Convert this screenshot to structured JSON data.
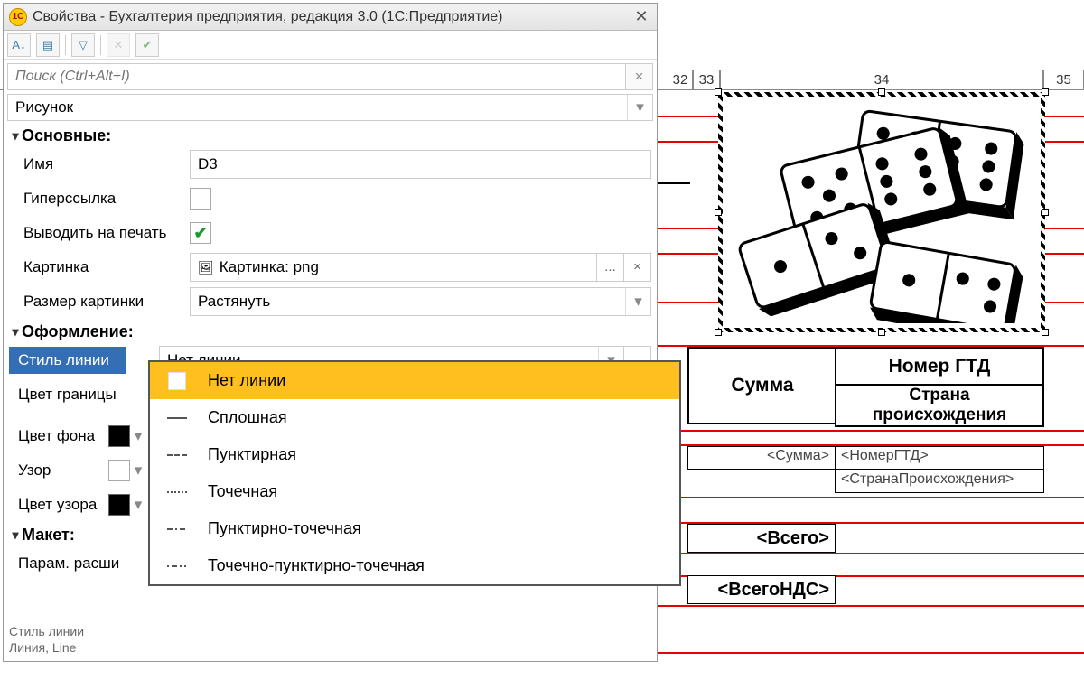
{
  "ruler": {
    "c32": "32",
    "c33": "33",
    "c34": "34",
    "c35": "35"
  },
  "grid": {
    "summ": "Сумма",
    "gtd": "Номер ГТД",
    "country": "Страна\nпроисхождения",
    "ph_summ": "<Сумма>",
    "ph_gtd": "<НомерГТД>",
    "ph_country": "<СтранаПроисхождения>",
    "total1": "<Всего>",
    "total2": "<ВсегоНДС>"
  },
  "dlg": {
    "title": "Свойства - Бухгалтерия предприятия, редакция 3.0  (1С:Предприятие)",
    "search_placeholder": "Поиск (Ctrl+Alt+I)",
    "combo1": "Рисунок",
    "sections": {
      "main": "Основные:",
      "design": "Оформление:",
      "layout": "Макет:"
    },
    "props": {
      "name_lbl": "Имя",
      "name_val": "D3",
      "hyperlink_lbl": "Гиперссылка",
      "print_lbl": "Выводить на печать",
      "print_val": true,
      "picture_lbl": "Картинка",
      "picture_val": "Картинка: png",
      "picsize_lbl": "Размер картинки",
      "picsize_val": "Растянуть",
      "linestyle_lbl": "Стиль линии",
      "linestyle_val": "Нет линии",
      "bordercolor_lbl": "Цвет границы",
      "bgcolor_lbl": "Цвет фона",
      "pattern_lbl": "Узор",
      "patterncolor_lbl": "Цвет узора",
      "paramext_lbl": "Парам. расши"
    },
    "footer1": "Стиль линии",
    "footer2": "Линия, Line",
    "dropdown": [
      "Нет линии",
      "Сплошная",
      "Пунктирная",
      "Точечная",
      "Пунктирно-точечная",
      "Точечно-пунктирно-точечная"
    ]
  }
}
